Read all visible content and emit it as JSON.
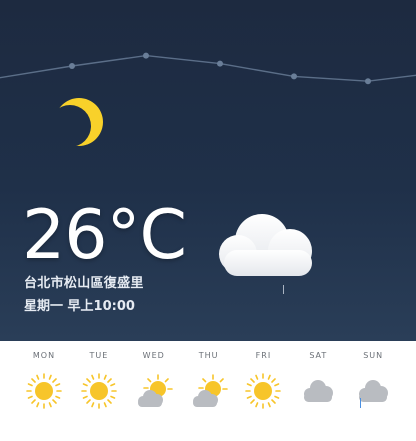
{
  "current": {
    "temperature": "26°C",
    "location": "台北市松山區復盛里",
    "datetime": "星期一 早上10:00",
    "condition_icon": "moon-icon",
    "weather_icon": "cloud-icon"
  },
  "trend_points": [
    {
      "value": 0.6
    },
    {
      "value": 0.45
    },
    {
      "value": 0.32
    },
    {
      "value": 0.42
    },
    {
      "value": 0.58
    },
    {
      "value": 0.64
    },
    {
      "value": 0.56
    }
  ],
  "forecast": [
    {
      "day": "MON",
      "icon": "sun-icon"
    },
    {
      "day": "TUE",
      "icon": "sun-icon"
    },
    {
      "day": "WED",
      "icon": "sun-cloud-icon"
    },
    {
      "day": "THU",
      "icon": "sun-cloud-icon"
    },
    {
      "day": "FRI",
      "icon": "sun-icon"
    },
    {
      "day": "SAT",
      "icon": "cloud-icon"
    },
    {
      "day": "SUN",
      "icon": "cloud-icon"
    }
  ],
  "colors": {
    "hero_top": "#1d2a40",
    "hero_bottom": "#2a3e58",
    "sun": "#f7c52a",
    "cloud_grey": "#b9bcc1",
    "moon": "#f8d12a"
  }
}
